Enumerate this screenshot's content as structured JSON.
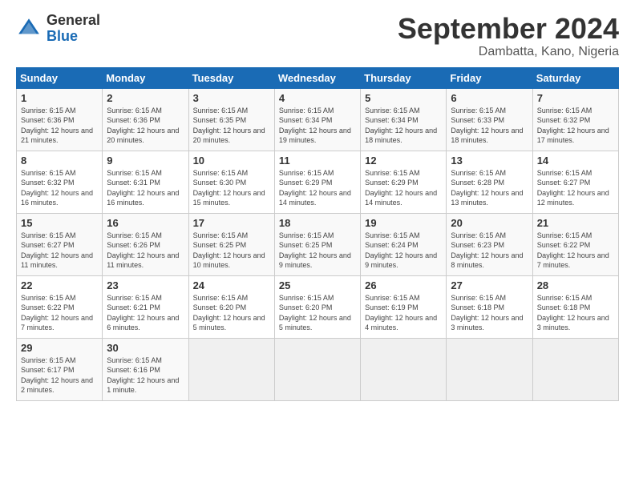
{
  "logo": {
    "general": "General",
    "blue": "Blue"
  },
  "header": {
    "month": "September 2024",
    "location": "Dambatta, Kano, Nigeria"
  },
  "weekdays": [
    "Sunday",
    "Monday",
    "Tuesday",
    "Wednesday",
    "Thursday",
    "Friday",
    "Saturday"
  ],
  "weeks": [
    [
      {
        "day": "1",
        "sunrise": "6:15 AM",
        "sunset": "6:36 PM",
        "daylight": "12 hours and 21 minutes."
      },
      {
        "day": "2",
        "sunrise": "6:15 AM",
        "sunset": "6:36 PM",
        "daylight": "12 hours and 20 minutes."
      },
      {
        "day": "3",
        "sunrise": "6:15 AM",
        "sunset": "6:35 PM",
        "daylight": "12 hours and 20 minutes."
      },
      {
        "day": "4",
        "sunrise": "6:15 AM",
        "sunset": "6:34 PM",
        "daylight": "12 hours and 19 minutes."
      },
      {
        "day": "5",
        "sunrise": "6:15 AM",
        "sunset": "6:34 PM",
        "daylight": "12 hours and 18 minutes."
      },
      {
        "day": "6",
        "sunrise": "6:15 AM",
        "sunset": "6:33 PM",
        "daylight": "12 hours and 18 minutes."
      },
      {
        "day": "7",
        "sunrise": "6:15 AM",
        "sunset": "6:32 PM",
        "daylight": "12 hours and 17 minutes."
      }
    ],
    [
      {
        "day": "8",
        "sunrise": "6:15 AM",
        "sunset": "6:32 PM",
        "daylight": "12 hours and 16 minutes."
      },
      {
        "day": "9",
        "sunrise": "6:15 AM",
        "sunset": "6:31 PM",
        "daylight": "12 hours and 16 minutes."
      },
      {
        "day": "10",
        "sunrise": "6:15 AM",
        "sunset": "6:30 PM",
        "daylight": "12 hours and 15 minutes."
      },
      {
        "day": "11",
        "sunrise": "6:15 AM",
        "sunset": "6:29 PM",
        "daylight": "12 hours and 14 minutes."
      },
      {
        "day": "12",
        "sunrise": "6:15 AM",
        "sunset": "6:29 PM",
        "daylight": "12 hours and 14 minutes."
      },
      {
        "day": "13",
        "sunrise": "6:15 AM",
        "sunset": "6:28 PM",
        "daylight": "12 hours and 13 minutes."
      },
      {
        "day": "14",
        "sunrise": "6:15 AM",
        "sunset": "6:27 PM",
        "daylight": "12 hours and 12 minutes."
      }
    ],
    [
      {
        "day": "15",
        "sunrise": "6:15 AM",
        "sunset": "6:27 PM",
        "daylight": "12 hours and 11 minutes."
      },
      {
        "day": "16",
        "sunrise": "6:15 AM",
        "sunset": "6:26 PM",
        "daylight": "12 hours and 11 minutes."
      },
      {
        "day": "17",
        "sunrise": "6:15 AM",
        "sunset": "6:25 PM",
        "daylight": "12 hours and 10 minutes."
      },
      {
        "day": "18",
        "sunrise": "6:15 AM",
        "sunset": "6:25 PM",
        "daylight": "12 hours and 9 minutes."
      },
      {
        "day": "19",
        "sunrise": "6:15 AM",
        "sunset": "6:24 PM",
        "daylight": "12 hours and 9 minutes."
      },
      {
        "day": "20",
        "sunrise": "6:15 AM",
        "sunset": "6:23 PM",
        "daylight": "12 hours and 8 minutes."
      },
      {
        "day": "21",
        "sunrise": "6:15 AM",
        "sunset": "6:22 PM",
        "daylight": "12 hours and 7 minutes."
      }
    ],
    [
      {
        "day": "22",
        "sunrise": "6:15 AM",
        "sunset": "6:22 PM",
        "daylight": "12 hours and 7 minutes."
      },
      {
        "day": "23",
        "sunrise": "6:15 AM",
        "sunset": "6:21 PM",
        "daylight": "12 hours and 6 minutes."
      },
      {
        "day": "24",
        "sunrise": "6:15 AM",
        "sunset": "6:20 PM",
        "daylight": "12 hours and 5 minutes."
      },
      {
        "day": "25",
        "sunrise": "6:15 AM",
        "sunset": "6:20 PM",
        "daylight": "12 hours and 5 minutes."
      },
      {
        "day": "26",
        "sunrise": "6:15 AM",
        "sunset": "6:19 PM",
        "daylight": "12 hours and 4 minutes."
      },
      {
        "day": "27",
        "sunrise": "6:15 AM",
        "sunset": "6:18 PM",
        "daylight": "12 hours and 3 minutes."
      },
      {
        "day": "28",
        "sunrise": "6:15 AM",
        "sunset": "6:18 PM",
        "daylight": "12 hours and 3 minutes."
      }
    ],
    [
      {
        "day": "29",
        "sunrise": "6:15 AM",
        "sunset": "6:17 PM",
        "daylight": "12 hours and 2 minutes."
      },
      {
        "day": "30",
        "sunrise": "6:15 AM",
        "sunset": "6:16 PM",
        "daylight": "12 hours and 1 minute."
      },
      null,
      null,
      null,
      null,
      null
    ]
  ]
}
